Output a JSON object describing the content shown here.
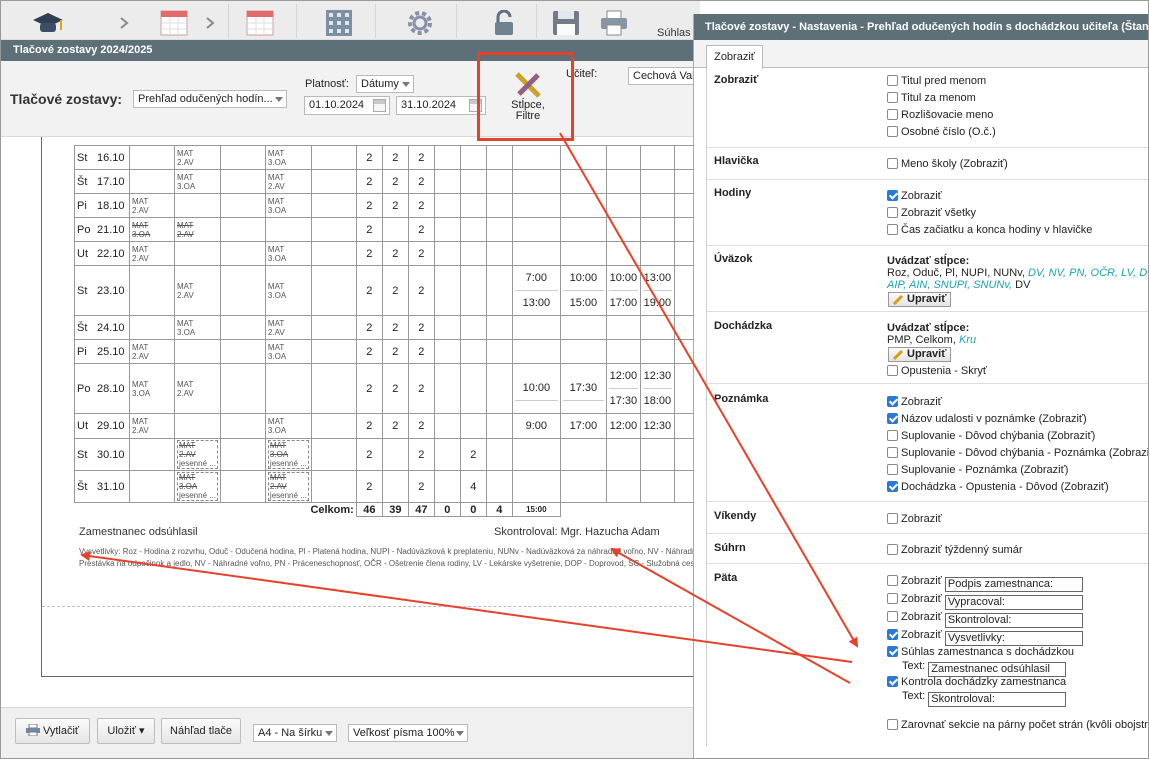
{
  "toolbar": {
    "suhlas_label": "Súhlas"
  },
  "window": {
    "title": "Tlačové zostavy 2024/2025"
  },
  "filters": {
    "label": "Tlačové zostavy:",
    "report_select": "Prehľad odučených hodín...",
    "platnost_label": "Platnosť:",
    "platnost_select": "Dátumy",
    "date_from": "01.10.2024",
    "date_to": "31.10.2024",
    "stlpce_line1": "Stĺpce,",
    "stlpce_line2": "Filtre",
    "ucitel_label": "Učiteľ:",
    "ucitel_value": "Cechová Val"
  },
  "report": {
    "rows": [
      {
        "dw": "St",
        "dt": "16.10",
        "c1": [],
        "c2": [
          "MAT",
          "2.AV"
        ],
        "c3": [],
        "c4": [
          "MAT",
          "3.OA"
        ],
        "n1": "2",
        "n2": "2",
        "n3": "2",
        "n4": "",
        "n5": "",
        "t": [
          "",
          "",
          "",
          ""
        ],
        "t2": [
          "",
          "",
          "",
          ""
        ],
        "struck": false
      },
      {
        "dw": "Št",
        "dt": "17.10",
        "c1": [],
        "c2": [
          "MAT",
          "3.OA"
        ],
        "c3": [],
        "c4": [
          "MAT",
          "2.AV"
        ],
        "n1": "2",
        "n2": "2",
        "n3": "2",
        "n4": "",
        "n5": "",
        "t": [
          "",
          "",
          "",
          ""
        ],
        "t2": [
          "",
          "",
          "",
          ""
        ],
        "struck": false
      },
      {
        "dw": "Pi",
        "dt": "18.10",
        "c1": [
          "MAT",
          "2.AV"
        ],
        "c2": [],
        "c3": [],
        "c4": [
          "MAT",
          "3.OA"
        ],
        "n1": "2",
        "n2": "2",
        "n3": "2",
        "n4": "",
        "n5": "",
        "t": [
          "",
          "",
          "",
          ""
        ],
        "t2": [
          "",
          "",
          "",
          ""
        ],
        "struck": false
      },
      {
        "dw": "Po",
        "dt": "21.10",
        "c1": [
          "MAT",
          "3.OA"
        ],
        "c2": [
          "MAT",
          "2.AV"
        ],
        "c3": [],
        "c4": [],
        "n1": "2",
        "n2": "",
        "n3": "2",
        "n4": "",
        "n5": "",
        "t": [
          "",
          "",
          "",
          ""
        ],
        "t2": [
          "",
          "",
          "",
          ""
        ],
        "struck": true
      },
      {
        "dw": "Ut",
        "dt": "22.10",
        "c1": [
          "MAT",
          "2.AV"
        ],
        "c2": [],
        "c3": [],
        "c4": [
          "MAT",
          "3.OA"
        ],
        "n1": "2",
        "n2": "2",
        "n3": "2",
        "n4": "",
        "n5": "",
        "t": [
          "",
          "",
          "",
          ""
        ],
        "t2": [
          "",
          "",
          "",
          ""
        ],
        "struck": false
      },
      {
        "dw": "St",
        "dt": "23.10",
        "c1": [],
        "c2": [
          "MAT",
          "2.AV"
        ],
        "c3": [],
        "c4": [
          "MAT",
          "3.OA"
        ],
        "n1": "2",
        "n2": "2",
        "n3": "2",
        "n4": "",
        "n5": "",
        "t": [
          "7:00",
          "10:00",
          "10:00",
          "13:00"
        ],
        "t2": [
          "13:00",
          "15:00",
          "17:00",
          "19:00"
        ],
        "struck": false
      },
      {
        "dw": "Št",
        "dt": "24.10",
        "c1": [],
        "c2": [
          "MAT",
          "3.OA"
        ],
        "c3": [],
        "c4": [
          "MAT",
          "2.AV"
        ],
        "n1": "2",
        "n2": "2",
        "n3": "2",
        "n4": "",
        "n5": "",
        "t": [
          "",
          "",
          "",
          ""
        ],
        "t2": [
          "",
          "",
          "",
          ""
        ],
        "struck": false
      },
      {
        "dw": "Pi",
        "dt": "25.10",
        "c1": [
          "MAT",
          "2.AV"
        ],
        "c2": [],
        "c3": [],
        "c4": [
          "MAT",
          "3.OA"
        ],
        "n1": "2",
        "n2": "2",
        "n3": "2",
        "n4": "",
        "n5": "",
        "t": [
          "",
          "",
          "",
          ""
        ],
        "t2": [
          "",
          "",
          "",
          ""
        ],
        "struck": false
      },
      {
        "dw": "Po",
        "dt": "28.10",
        "c1": [
          "MAT",
          "3.OA"
        ],
        "c2": [
          "MAT",
          "2.AV"
        ],
        "c3": [],
        "c4": [],
        "n1": "2",
        "n2": "2",
        "n3": "2",
        "n4": "",
        "n5": "",
        "t": [
          "10:00",
          "17:30",
          "12:00",
          "12:30"
        ],
        "t2": [
          "",
          "",
          "17:30",
          "18:00"
        ],
        "struck": false
      },
      {
        "dw": "Ut",
        "dt": "29.10",
        "c1": [
          "MAT",
          "2.AV"
        ],
        "c2": [],
        "c3": [],
        "c4": [
          "MAT",
          "3.OA"
        ],
        "n1": "2",
        "n2": "2",
        "n3": "2",
        "n4": "",
        "n5": "",
        "t": [
          "9:00",
          "17:00",
          "12:00",
          "12:30"
        ],
        "t2": [
          "",
          "",
          "",
          ""
        ],
        "struck": false
      },
      {
        "dw": "St",
        "dt": "30.10",
        "c1": [],
        "c2": [
          "MAT",
          "2.AV",
          "jesenné ..."
        ],
        "c3": [],
        "c4": [
          "MAT",
          "3.OA",
          "jesenné ..."
        ],
        "n1": "2",
        "n2": "",
        "n3": "2",
        "n4": "",
        "n5": "2",
        "t": [
          "",
          "",
          "",
          ""
        ],
        "t2": [
          "",
          "",
          "",
          ""
        ],
        "struck": true
      },
      {
        "dw": "Št",
        "dt": "31.10",
        "c1": [],
        "c2": [
          "MAT",
          "3.OA",
          "jesenné ..."
        ],
        "c3": [],
        "c4": [
          "MAT",
          "2.AV",
          "jesenné ..."
        ],
        "n1": "2",
        "n2": "",
        "n3": "2",
        "n4": "",
        "n5": "4",
        "t": [
          "",
          "",
          "",
          ""
        ],
        "t2": [
          "",
          "",
          "",
          ""
        ],
        "struck": true
      }
    ],
    "total_label": "Celkom:",
    "totals": [
      "46",
      "39",
      "47",
      "0",
      "0",
      "4",
      "15:00"
    ],
    "sig_left": "Zamestnanec odsúhlasil",
    "sig_right": "Skontroloval: Mgr. Hazucha Adam",
    "legend1": "Vysvetlivky: Roz - Hodina z rozvrhu, Oduč - Odučená hodina, Pl - Platená hodina, NUPI - Nadúväzková k preplateniu, NUNv - Nadúväzková za náhradné voľno, NV - Náhradné voľno, Pr...",
    "legend2": "Prestávka na odpočinok a jedlo, NV - Náhradné voľno, PN - Práceneschopnosť, OČR - Ošetrenie člena rodiny, LV - Lekárske vyšetrenie, DOP - Doprovod, SC - Služobná cesta..."
  },
  "bottom": {
    "print": "Vytlačiť",
    "save": "Uložiť ▾",
    "preview": "Náhľad tlače",
    "paper": "A4 - Na šírku",
    "font": "Veľkosť písma 100%"
  },
  "dialog": {
    "title": "Tlačové zostavy - Nastavenia - Prehľad odučených hodín s dochádzkou učiteľa (Štanda",
    "tab": "Zobraziť",
    "sections": {
      "zobrazit": {
        "title": "Zobraziť",
        "o1": "Titul pred menom",
        "o2": "Titul za menom",
        "o3": "Rozlišovacie meno",
        "o4": "Osobné číslo (O.č.)"
      },
      "hlavicka": {
        "title": "Hlavička",
        "o1": "Meno školy (Zobraziť)"
      },
      "hodiny": {
        "title": "Hodiny",
        "o1": "Zobraziť",
        "o2": "Zobraziť všetky",
        "o3": "Čas začiatku a konca hodiny v hlavičke"
      },
      "uvazok": {
        "title": "Úväzok",
        "head": "Uvádzať stĺpce:",
        "plain1": "Roz, Oduč, Pl, NUPI, NUNv,",
        "teal1": "DV, NV, PN, OČR, LV, DO",
        "teal2": "AIP, AIN, SNUPI, SNUNv,",
        "plain2": "DV",
        "btn": "Upraviť"
      },
      "dochadzka": {
        "title": "Dochádzka",
        "head": "Uvádzať stĺpce:",
        "plain1": "PMP, Celkom,",
        "teal1": "Kru",
        "btn": "Upraviť",
        "o1": "Opustenia - Skryť"
      },
      "poznamka": {
        "title": "Poznámka",
        "o1": "Zobraziť",
        "o2": "Názov udalosti v poznámke (Zobraziť)",
        "o3": "Suplovanie - Dôvod chýbania (Zobraziť)",
        "o4": "Suplovanie - Dôvod chýbania - Poznámka (Zobrazi",
        "o5": "Suplovanie - Poznámka (Zobraziť)",
        "o6": "Dochádzka - Opustenia - Dôvod (Zobraziť)"
      },
      "vikendy": {
        "title": "Víkendy",
        "o1": "Zobraziť"
      },
      "suhrn": {
        "title": "Súhrn",
        "o1": "Zobraziť týždenný sumár"
      },
      "pata": {
        "title": "Päta",
        "show": "Zobraziť",
        "f1": "Podpis zamestnanca:",
        "f2": "Vypracoval:",
        "f3": "Skontroloval:",
        "f4": "Vysvetlivky:",
        "s1": "Súhlas zamestnanca s dochádzkou",
        "text_label": "Text:",
        "s1_text": "Zamestnanec odsúhlasil",
        "s2": "Kontrola dochádzky zamestnanca",
        "s2_text": "Skontroloval:",
        "o_last": "Zarovnať sekcie na párny počet strán (kvôli obojstra"
      }
    }
  }
}
